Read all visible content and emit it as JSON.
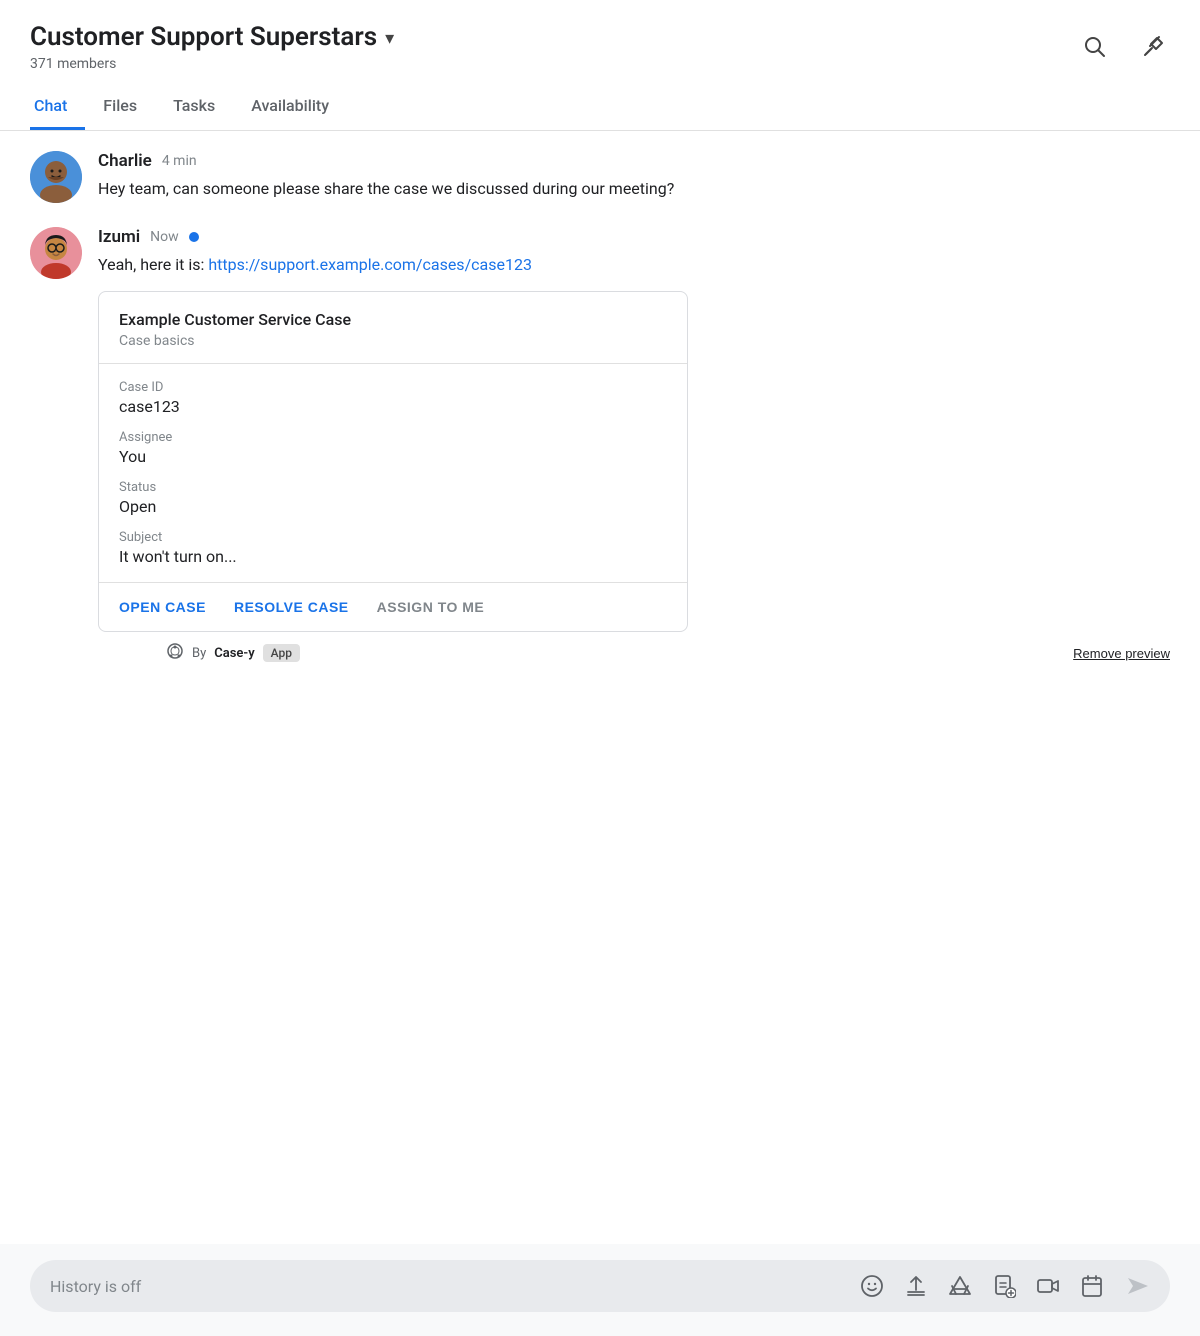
{
  "header": {
    "title": "Customer Support Superstars",
    "members": "371 members",
    "dropdown_icon": "▾",
    "search_icon": "🔍",
    "pin_icon": "✦"
  },
  "tabs": [
    {
      "label": "Chat",
      "active": true
    },
    {
      "label": "Files",
      "active": false
    },
    {
      "label": "Tasks",
      "active": false
    },
    {
      "label": "Availability",
      "active": false
    }
  ],
  "messages": [
    {
      "author": "Charlie",
      "time": "4 min",
      "online": false,
      "text": "Hey team, can someone please share the case we discussed during our meeting?"
    },
    {
      "author": "Izumi",
      "time": "Now",
      "online": true,
      "text_prefix": "Yeah, here it is: ",
      "link_text": "https://support.example.com/cases/case123",
      "link_href": "https://support.example.com/cases/case123"
    }
  ],
  "case_card": {
    "title": "Example Customer Service Case",
    "subtitle": "Case basics",
    "fields": [
      {
        "label": "Case ID",
        "value": "case123"
      },
      {
        "label": "Assignee",
        "value": "You"
      },
      {
        "label": "Status",
        "value": "Open"
      },
      {
        "label": "Subject",
        "value": "It won't turn on..."
      }
    ],
    "actions": [
      {
        "label": "OPEN CASE",
        "style": "blue"
      },
      {
        "label": "RESOLVE CASE",
        "style": "blue"
      },
      {
        "label": "ASSIGN TO ME",
        "style": "gray"
      }
    ]
  },
  "attribution": {
    "by_text": "By",
    "app_name": "Case-y",
    "badge": "App",
    "remove_label": "Remove preview"
  },
  "input_bar": {
    "placeholder": "History is off"
  }
}
